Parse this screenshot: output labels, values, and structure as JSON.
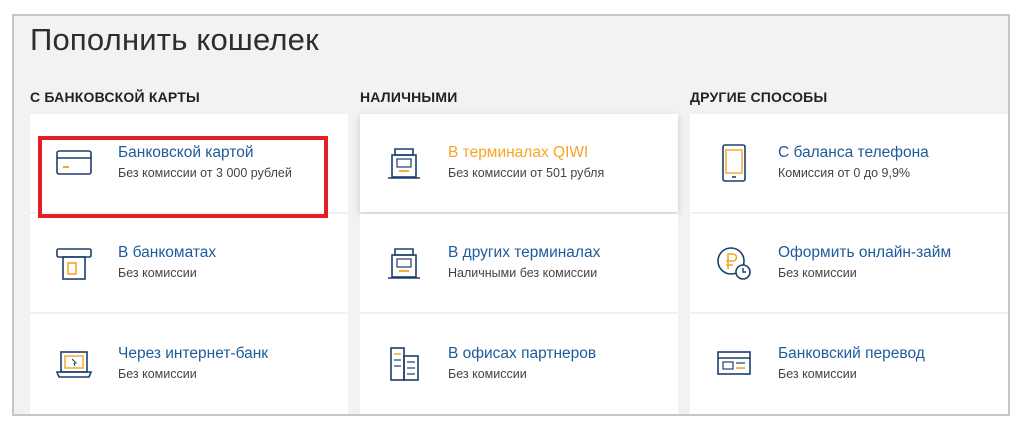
{
  "page": {
    "title": "Пополнить кошелек"
  },
  "columns": [
    {
      "heading": "С банковской карты",
      "items": [
        {
          "title": "Банковской картой",
          "subtitle": "Без комиссии от 3 000 рублей",
          "icon": "bank-card-icon"
        },
        {
          "title": "В банкоматах",
          "subtitle": "Без комиссии",
          "icon": "atm-icon"
        },
        {
          "title": "Через интернет-банк",
          "subtitle": "Без комиссии",
          "icon": "laptop-icon"
        }
      ]
    },
    {
      "heading": "Наличными",
      "items": [
        {
          "title": "В терминалах QIWI",
          "subtitle": "Без комиссии от 501 рубля",
          "icon": "qiwi-terminal-icon"
        },
        {
          "title": "В других терминалах",
          "subtitle": "Наличными без комиссии",
          "icon": "terminal-icon"
        },
        {
          "title": "В офисах партнеров",
          "subtitle": "Без комиссии",
          "icon": "office-building-icon"
        }
      ]
    },
    {
      "heading": "Другие способы",
      "items": [
        {
          "title": "С баланса телефона",
          "subtitle": "Комиссия от 0 до 9,9%",
          "icon": "mobile-phone-icon"
        },
        {
          "title": "Оформить онлайн-займ",
          "subtitle": "Без комиссии",
          "icon": "ruble-clock-icon"
        },
        {
          "title": "Банковский перевод",
          "subtitle": "Без комиссии",
          "icon": "bank-transfer-icon"
        }
      ]
    }
  ],
  "colors": {
    "link": "#1d5b9b",
    "active_link": "#f5a623",
    "highlight_border": "#e41e26",
    "icon_stroke": "#1d3f6e",
    "icon_accent": "#f5a623"
  }
}
